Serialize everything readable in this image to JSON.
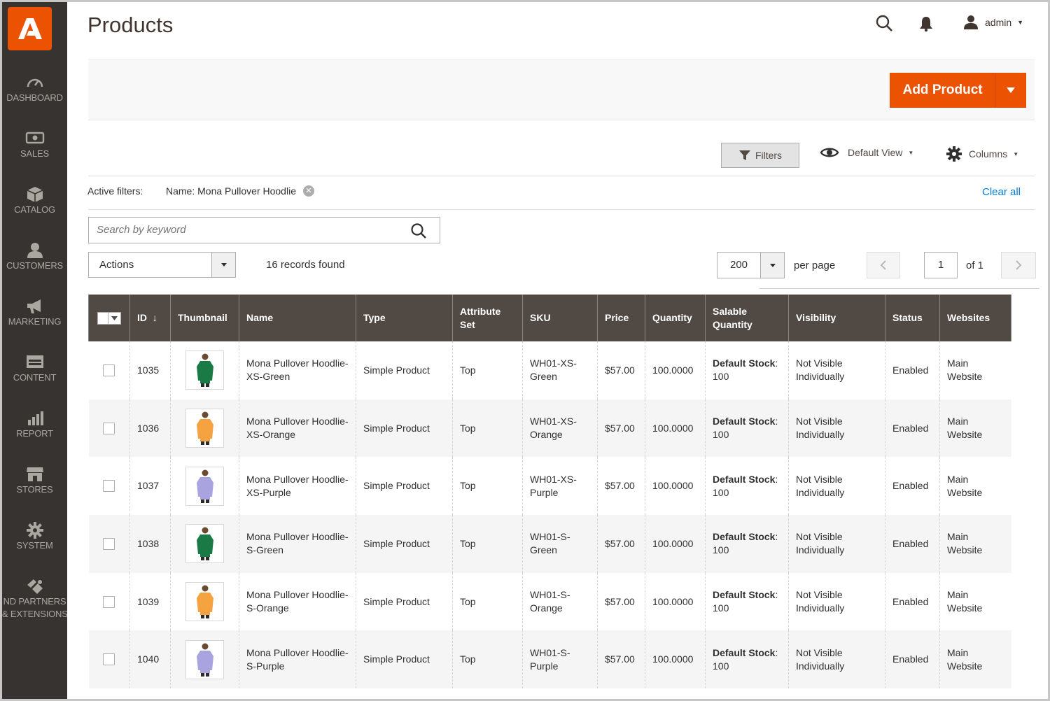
{
  "sidebar": {
    "items": [
      {
        "label": "DASHBOARD",
        "icon": "dashboard-icon"
      },
      {
        "label": "SALES",
        "icon": "dollar-icon"
      },
      {
        "label": "CATALOG",
        "icon": "cube-icon"
      },
      {
        "label": "CUSTOMERS",
        "icon": "user-icon"
      },
      {
        "label": "MARKETING",
        "icon": "megaphone-icon"
      },
      {
        "label": "CONTENT",
        "icon": "layout-icon"
      },
      {
        "label": "REPORT",
        "icon": "bar-chart-icon"
      },
      {
        "label": "STORES",
        "icon": "store-icon"
      },
      {
        "label": "SYSTEM",
        "icon": "gear-icon"
      },
      {
        "label": "ND PARTNERS",
        "label2": "& EXTENSIONS",
        "icon": "puzzle-icon"
      }
    ]
  },
  "header": {
    "title": "Products",
    "user": "admin"
  },
  "action_bar": {
    "add_product": "Add Product"
  },
  "toolbar": {
    "filters": "Filters",
    "view": "Default View",
    "columns": "Columns"
  },
  "active_filters": {
    "label": "Active filters:",
    "value": "Name: Mona Pullover Hoodlie",
    "clear_all": "Clear all"
  },
  "search": {
    "placeholder": "Search by keyword"
  },
  "grid_controls": {
    "actions": "Actions",
    "records": "16 records found",
    "per_page_value": "200",
    "per_page_label": "per page",
    "page": "1",
    "of_pages": "of 1"
  },
  "columns": [
    "ID",
    "Thumbnail",
    "Name",
    "Type",
    "Attribute Set",
    "SKU",
    "Price",
    "Quantity",
    "Salable Quantity",
    "Visibility",
    "Status",
    "Websites"
  ],
  "sort_indicator": "↓",
  "rows": [
    {
      "id": "1035",
      "name": "Mona Pullover Hoodlie-XS-Green",
      "type": "Simple Product",
      "attr": "Top",
      "sku": "WH01-XS-Green",
      "price": "$57.00",
      "qty": "100.0000",
      "salable_label": "Default Stock",
      "salable_value": ": 100",
      "visibility": "Not Visible Individually",
      "status": "Enabled",
      "websites": "Main Website",
      "color": "#1a7a45"
    },
    {
      "id": "1036",
      "name": "Mona Pullover Hoodlie-XS-Orange",
      "type": "Simple Product",
      "attr": "Top",
      "sku": "WH01-XS-Orange",
      "price": "$57.00",
      "qty": "100.0000",
      "salable_label": "Default Stock",
      "salable_value": ": 100",
      "visibility": "Not Visible Individually",
      "status": "Enabled",
      "websites": "Main Website",
      "color": "#f4a340"
    },
    {
      "id": "1037",
      "name": "Mona Pullover Hoodlie-XS-Purple",
      "type": "Simple Product",
      "attr": "Top",
      "sku": "WH01-XS-Purple",
      "price": "$57.00",
      "qty": "100.0000",
      "salable_label": "Default Stock",
      "salable_value": ": 100",
      "visibility": "Not Visible Individually",
      "status": "Enabled",
      "websites": "Main Website",
      "color": "#a9a4e0"
    },
    {
      "id": "1038",
      "name": "Mona Pullover Hoodlie-S-Green",
      "type": "Simple Product",
      "attr": "Top",
      "sku": "WH01-S-Green",
      "price": "$57.00",
      "qty": "100.0000",
      "salable_label": "Default Stock",
      "salable_value": ": 100",
      "visibility": "Not Visible Individually",
      "status": "Enabled",
      "websites": "Main Website",
      "color": "#1a7a45"
    },
    {
      "id": "1039",
      "name": "Mona Pullover Hoodlie-S-Orange",
      "type": "Simple Product",
      "attr": "Top",
      "sku": "WH01-S-Orange",
      "price": "$57.00",
      "qty": "100.0000",
      "salable_label": "Default Stock",
      "salable_value": ": 100",
      "visibility": "Not Visible Individually",
      "status": "Enabled",
      "websites": "Main Website",
      "color": "#f4a340"
    },
    {
      "id": "1040",
      "name": "Mona Pullover Hoodlie-S-Purple",
      "type": "Simple Product",
      "attr": "Top",
      "sku": "WH01-S-Purple",
      "price": "$57.00",
      "qty": "100.0000",
      "salable_label": "Default Stock",
      "salable_value": ": 100",
      "visibility": "Not Visible Individually",
      "status": "Enabled",
      "websites": "Main Website",
      "color": "#a9a4e0"
    }
  ],
  "colors": {
    "accent": "#eb5202",
    "sidebar": "#373330",
    "header_row": "#514943",
    "link": "#007bdb"
  }
}
